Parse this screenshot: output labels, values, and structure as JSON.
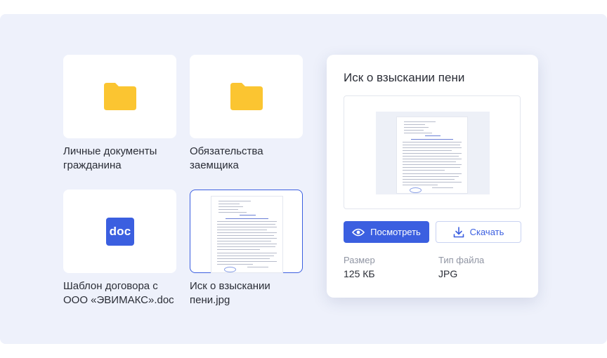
{
  "files": [
    {
      "name": "Личные документы\nгражданина",
      "type": "folder",
      "icon": "folder-icon"
    },
    {
      "name": "Обязательства\nзаемщика",
      "type": "folder",
      "icon": "folder-icon"
    },
    {
      "name": "Шаблон договора с\nООО «ЭВИМАКС».doc",
      "type": "doc",
      "icon": "doc-icon",
      "badge": "doc"
    },
    {
      "name": "Иск о взыскании\nпени.jpg",
      "type": "image",
      "icon": "image-thumbnail",
      "selected": true
    }
  ],
  "details": {
    "title": "Иск о взыскании пени",
    "view_label": "Посмотреть",
    "download_label": "Скачать",
    "size_label": "Размер",
    "size_value": "125 КБ",
    "type_label": "Тип файла",
    "type_value": "JPG"
  },
  "colors": {
    "accent": "#3b5fe0",
    "folder": "#fbc531",
    "background": "#eef1fb"
  }
}
